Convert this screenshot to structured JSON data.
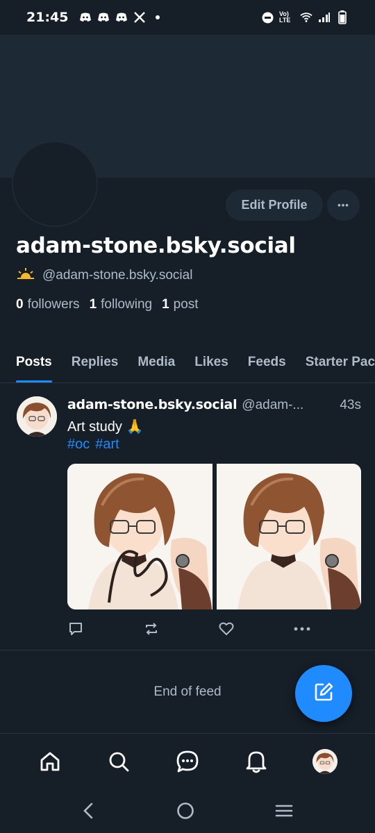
{
  "status_bar": {
    "time": "21:45",
    "left_icons": [
      "discord-icon",
      "discord-icon",
      "discord-icon",
      "x-icon",
      "dot-icon"
    ],
    "right_icons": [
      "do-not-disturb-icon",
      "volte-icon",
      "wifi-icon",
      "signal-icon",
      "battery-icon"
    ],
    "volte_text": "Vo) LTE"
  },
  "profile": {
    "edit_label": "Edit Profile",
    "more_label": "•••",
    "display_name": "adam-stone.bsky.social",
    "handle_emoji": "🌥",
    "handle": "@adam-stone.bsky.social",
    "stats": {
      "followers_count": "0",
      "followers_label": "followers",
      "following_count": "1",
      "following_label": "following",
      "posts_count": "1",
      "posts_label": "post"
    }
  },
  "tabs": [
    {
      "label": "Posts",
      "active": true
    },
    {
      "label": "Replies",
      "active": false
    },
    {
      "label": "Media",
      "active": false
    },
    {
      "label": "Likes",
      "active": false
    },
    {
      "label": "Feeds",
      "active": false
    },
    {
      "label": "Starter Packs",
      "active": false
    }
  ],
  "post": {
    "author": "adam-stone.bsky.social",
    "handle": "@adam-...",
    "time": "43s",
    "text": "Art study 🙏",
    "tags": [
      "#oc",
      "#art"
    ],
    "images": [
      "character-art-signed",
      "character-art"
    ],
    "actions": [
      "reply-icon",
      "repost-icon",
      "like-icon",
      "more-icon"
    ]
  },
  "feed": {
    "end_text": "End of feed"
  },
  "bottom_nav": [
    "home-icon",
    "search-icon",
    "chat-icon",
    "notifications-icon",
    "profile-avatar"
  ],
  "system_nav": [
    "back-icon",
    "home-circle-icon",
    "recents-icon"
  ],
  "colors": {
    "background": "#161e27",
    "banner": "#1e2936",
    "accent": "#208bfe",
    "muted_text": "#aebbc9"
  }
}
